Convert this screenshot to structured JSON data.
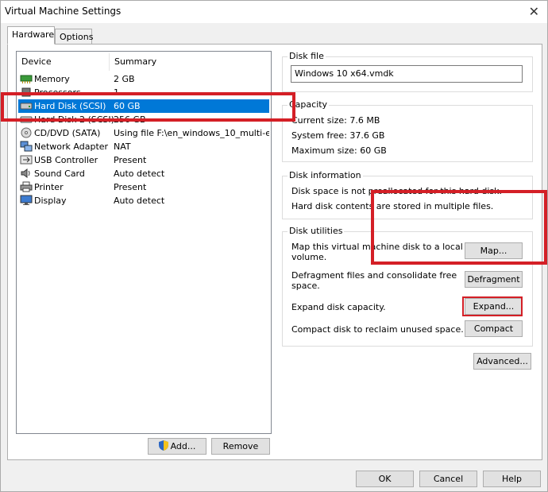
{
  "window": {
    "title": "Virtual Machine Settings"
  },
  "tabs": [
    {
      "label": "Hardware"
    },
    {
      "label": "Options"
    }
  ],
  "device_list": {
    "headers": {
      "device": "Device",
      "summary": "Summary"
    },
    "rows": [
      {
        "device": "Memory",
        "summary": "2 GB",
        "icon": "memory-icon"
      },
      {
        "device": "Processors",
        "summary": "1",
        "icon": "processor-icon"
      },
      {
        "device": "Hard Disk (SCSI)",
        "summary": "60 GB",
        "icon": "hard-disk-icon",
        "selected": true
      },
      {
        "device": "Hard Disk 2 (SCSI)",
        "summary": "256 GB",
        "icon": "hard-disk-icon"
      },
      {
        "device": "CD/DVD (SATA)",
        "summary": "Using file F:\\en_windows_10_multi-e...",
        "icon": "cd-dvd-icon"
      },
      {
        "device": "Network Adapter",
        "summary": "NAT",
        "icon": "network-adapter-icon"
      },
      {
        "device": "USB Controller",
        "summary": "Present",
        "icon": "usb-icon"
      },
      {
        "device": "Sound Card",
        "summary": "Auto detect",
        "icon": "speaker-icon"
      },
      {
        "device": "Printer",
        "summary": "Present",
        "icon": "printer-icon"
      },
      {
        "device": "Display",
        "summary": "Auto detect",
        "icon": "display-icon"
      }
    ]
  },
  "list_buttons": {
    "add": "Add...",
    "remove": "Remove"
  },
  "disk_file": {
    "label": "Disk file",
    "value": "Windows 10 x64.vmdk"
  },
  "capacity": {
    "label": "Capacity",
    "current_size": "Current size:  7.6 MB",
    "system_free": "System free:  37.6 GB",
    "maximum_size": "Maximum size:  60 GB"
  },
  "disk_info": {
    "label": "Disk information",
    "line1": "Disk space is not preallocated for this hard disk.",
    "line2": "Hard disk contents are stored in multiple files."
  },
  "disk_utilities": {
    "label": "Disk utilities",
    "map_desc_1": "Map this virtual machine disk to a local",
    "map_desc_2": "volume.",
    "map_button": "Map...",
    "defrag_desc_1": "Defragment files and consolidate free",
    "defrag_desc_2": "space.",
    "defrag_button": "Defragment",
    "expand_desc": "Expand disk capacity.",
    "expand_button": "Expand...",
    "compact_desc": "Compact disk to reclaim unused space.",
    "compact_button": "Compact"
  },
  "advanced_button": "Advanced...",
  "footer": {
    "ok": "OK",
    "cancel": "Cancel",
    "help": "Help"
  },
  "colors": {
    "selection": "#0078d7",
    "annotation_red": "#d41f26"
  }
}
